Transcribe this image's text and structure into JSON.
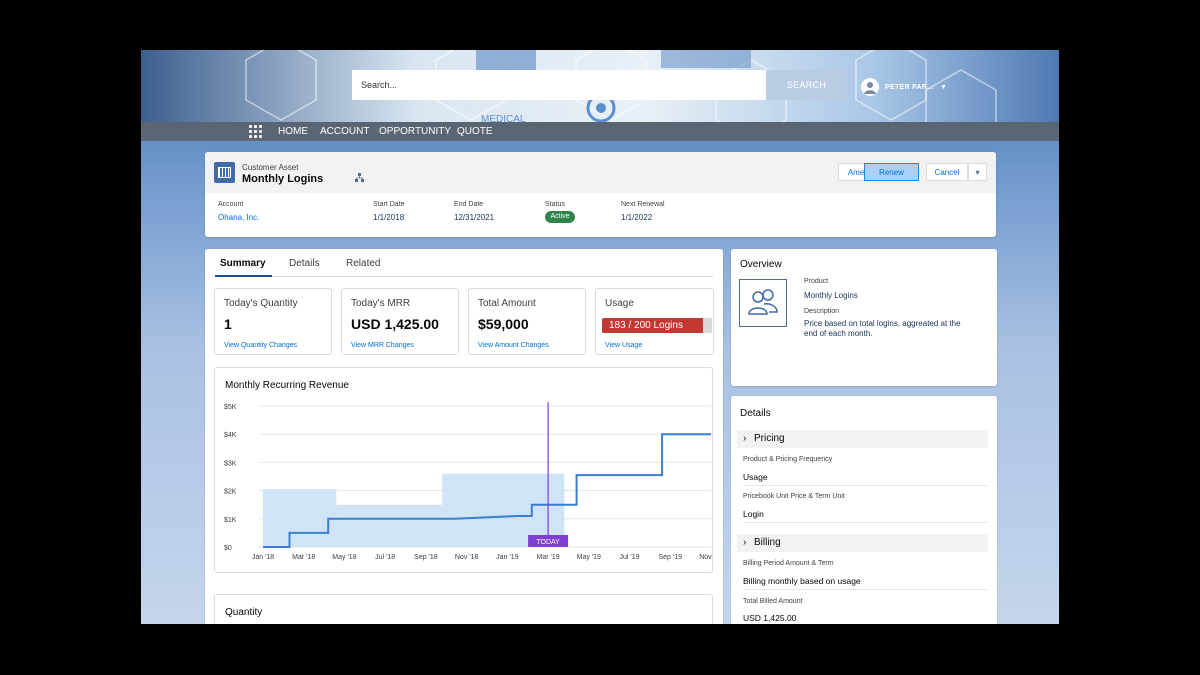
{
  "header": {
    "search_placeholder": "Search...",
    "search_button": "SEARCH",
    "user_name": "PETER PAR...",
    "nav": [
      "HOME",
      "ACCOUNT",
      "OPPORTUNITY",
      "QUOTE"
    ]
  },
  "record": {
    "type": "Customer Asset",
    "title": "Monthly Logins",
    "actions": [
      "Amend",
      "Renew",
      "Cancel"
    ],
    "fields": {
      "account_label": "Account",
      "account_value": "Ohana, Inc.",
      "start_label": "Start Date",
      "start_value": "1/1/2018",
      "end_label": "End Date",
      "end_value": "12/31/2021",
      "status_label": "Status",
      "status_value": "Active",
      "renewal_label": "Next Renewal",
      "renewal_value": "1/1/2022"
    }
  },
  "tabs": [
    "Summary",
    "Details",
    "Related"
  ],
  "tiles": [
    {
      "title": "Today's Quantity",
      "value": "1",
      "link": "View Quantity Changes"
    },
    {
      "title": "Today's MRR",
      "value": "USD 1,425.00",
      "link": "View MRR Changes"
    },
    {
      "title": "Total Amount",
      "value": "$59,000",
      "link": "View Amount Changes"
    },
    {
      "title": "Usage",
      "value": "183 / 200 Logins",
      "link": "View Usage",
      "fraction": 0.915
    }
  ],
  "chart_data": {
    "type": "line",
    "title": "Monthly Recurring Revenue",
    "x": [
      "Jan '18",
      "Mar '18",
      "May '18",
      "Jul '18",
      "Sep '18",
      "Nov '18",
      "Jan '19",
      "Mar '19",
      "May '19",
      "Jul '19",
      "Sep '19",
      "Nov '19"
    ],
    "y_ticks": [
      "$0",
      "$1K",
      "$2K",
      "$3K",
      "$4K",
      "$5K"
    ],
    "ylim": [
      0,
      5000
    ],
    "today_label": "TODAY",
    "today_x": 14.0,
    "series": [
      {
        "role": "mrr-line",
        "points": [
          [
            0,
            0
          ],
          [
            1,
            0
          ],
          [
            1.3,
            0
          ],
          [
            1.3,
            500
          ],
          [
            2.4,
            500
          ],
          [
            2.4,
            500
          ],
          [
            3.2,
            500
          ],
          [
            3.2,
            1000
          ],
          [
            4.0,
            1000
          ],
          [
            5.0,
            1000
          ],
          [
            6.0,
            1000
          ],
          [
            6.5,
            1000
          ],
          [
            7.1,
            1000
          ],
          [
            7.9,
            1000
          ],
          [
            8.0,
            1000
          ],
          [
            8.0,
            1000
          ],
          [
            9.4,
            1000
          ],
          [
            12.5,
            1100
          ],
          [
            13.2,
            1100
          ],
          [
            13.2,
            1500
          ],
          [
            14.0,
            1500
          ],
          [
            15.0,
            1500
          ],
          [
            15.4,
            1500
          ],
          [
            15.4,
            2550
          ],
          [
            16.6,
            2550
          ],
          [
            17.0,
            2550
          ],
          [
            19.6,
            2550
          ],
          [
            19.6,
            4000
          ],
          [
            22.0,
            4000
          ]
        ],
        "color": "#3a7fcc"
      }
    ],
    "area_bands": [
      {
        "x0": 0,
        "x1": 3.6,
        "y": 2050
      },
      {
        "x0": 3.6,
        "x1": 8.8,
        "y": 1500
      },
      {
        "x0": 8.8,
        "x1": 14.8,
        "y": 2600
      }
    ]
  },
  "quantity_title": "Quantity",
  "overview": {
    "title": "Overview",
    "product_label": "Product",
    "product_value": "Monthly Logins",
    "desc_label": "Description",
    "desc_value": "Price based on total logins, aggreated at the end of each month."
  },
  "details": {
    "title": "Details",
    "sections": [
      {
        "name": "Pricing",
        "fields": [
          {
            "label": "Product & Pricing Frequency",
            "value": "Usage"
          },
          {
            "label": "Pricebook Unit Price & Term Unit",
            "value": "Login"
          }
        ]
      },
      {
        "name": "Billing",
        "fields": [
          {
            "label": "Billing Period Amount & Term",
            "value": "Billing monthly based on usage"
          },
          {
            "label": "Total Billed Amount",
            "value": "USD 1,425.00"
          }
        ]
      }
    ]
  }
}
